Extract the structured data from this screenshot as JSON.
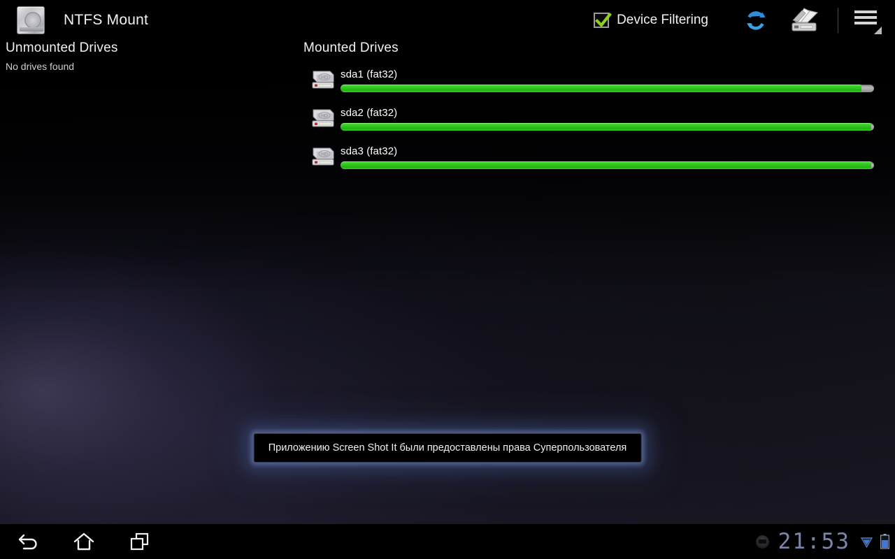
{
  "app": {
    "title": "NTFS Mount",
    "icon": "hard-drive-icon"
  },
  "header": {
    "device_filtering_label": "Device Filtering",
    "device_filtering_checked": true,
    "refresh_icon": "refresh-icon",
    "unmount_icon": "unmount-drive-icon",
    "menu_icon": "overflow-menu-icon",
    "check_color": "#8fd118"
  },
  "unmounted": {
    "heading": "Unmounted Drives",
    "empty_text": "No drives found",
    "drives": []
  },
  "mounted": {
    "heading": "Mounted Drives",
    "drives": [
      {
        "name": "sda1 (fat32)",
        "fill_percent": 97.6,
        "icon": "hd-drive-icon"
      },
      {
        "name": "sda2 (fat32)",
        "fill_percent": 99.5,
        "icon": "hd-drive-icon"
      },
      {
        "name": "sda3 (fat32)",
        "fill_percent": 99.5,
        "icon": "hd-drive-icon"
      }
    ],
    "bar_fill_color": "#2fc91d",
    "bar_track_color": "#a8a8a8"
  },
  "toast": {
    "message": "Приложению Screen Shot It были предоставлены права Суперпользователя"
  },
  "navbar": {
    "back_icon": "back-arrow-icon",
    "home_icon": "home-icon",
    "recents_icon": "recent-apps-icon",
    "notification_icon": "notification-dot-icon",
    "clock": "21:53",
    "wifi_icon": "wifi-signal-icon",
    "battery_icon": "battery-icon",
    "clock_color": "#7b86a8"
  }
}
